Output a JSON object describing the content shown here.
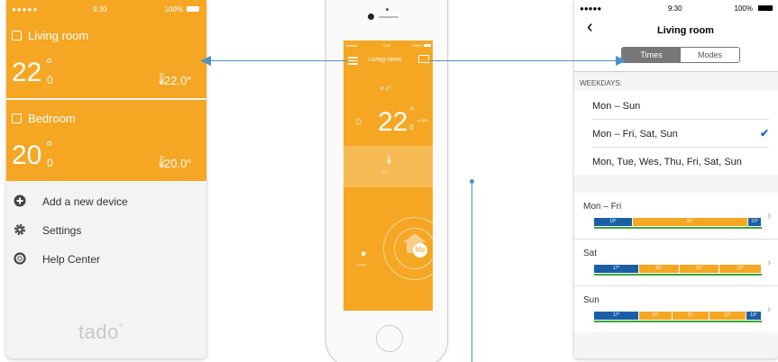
{
  "left_panel": {
    "status": {
      "carrier": "●●●●● ",
      "time": "9:30",
      "battery": "100%"
    },
    "rooms": [
      {
        "name": "Living room",
        "temp": "22",
        "decimal": "0",
        "degree": "°",
        "current": "22.0°"
      },
      {
        "name": "Bedroom",
        "temp": "20",
        "decimal": "0",
        "degree": "°",
        "current": "20.0°"
      }
    ],
    "menu": [
      {
        "label": "Add a new device",
        "icon": "plus-circle-icon"
      },
      {
        "label": "Settings",
        "icon": "gear-icon"
      },
      {
        "label": "Help Center",
        "icon": "lifebuoy-icon"
      }
    ],
    "logo": "tado",
    "logo_mark": "°"
  },
  "phone": {
    "status": {
      "carrier": "●●●●● ",
      "time": "9:30",
      "battery": "100%"
    },
    "title": "Living room",
    "outside": "2°",
    "temp": "22",
    "degree": "°",
    "decimal": "0",
    "humidity": "45%",
    "target": "22°",
    "person_label": "Laura",
    "me_label": "Me"
  },
  "right_panel": {
    "status": {
      "carrier": "●●●●● ",
      "time": "9:30",
      "battery": "100%"
    },
    "title": "Living room",
    "tabs": [
      "Times",
      "Modes"
    ],
    "section": "WEEKDAYS:",
    "options": [
      {
        "label": "Mon – Sun",
        "selected": false
      },
      {
        "label": "Mon – Fri, Sat, Sun",
        "selected": true
      },
      {
        "label": "Mon, Tue, Wes, Thu, Fri, Sat, Sun",
        "selected": false
      }
    ],
    "schedules": [
      {
        "name": "Mon – Fri",
        "blocks": [
          {
            "t": "19°",
            "k": "cold",
            "w": 0.23
          },
          {
            "t": "21°",
            "k": "warm",
            "w": 0.69
          },
          {
            "t": "19°",
            "k": "cold",
            "w": 0.08
          }
        ]
      },
      {
        "name": "Sat",
        "blocks": [
          {
            "t": "17°",
            "k": "cold",
            "w": 0.27
          },
          {
            "t": "20°",
            "k": "warm",
            "w": 0.24
          },
          {
            "t": "21°",
            "k": "warm",
            "w": 0.24
          },
          {
            "t": "22°",
            "k": "warm",
            "w": 0.25
          }
        ]
      },
      {
        "name": "Sun",
        "blocks": [
          {
            "t": "17°",
            "k": "cold",
            "w": 0.27
          },
          {
            "t": "20°",
            "k": "warm",
            "w": 0.2
          },
          {
            "t": "21°",
            "k": "warm",
            "w": 0.22
          },
          {
            "t": "22°",
            "k": "warm",
            "w": 0.22
          },
          {
            "t": "19°",
            "k": "cold",
            "w": 0.09
          }
        ]
      }
    ]
  },
  "colors": {
    "tado_orange": "#f5a623",
    "connector": "#4f90c6",
    "cold": "#1a5fa5",
    "check": "#1e6ec8"
  }
}
